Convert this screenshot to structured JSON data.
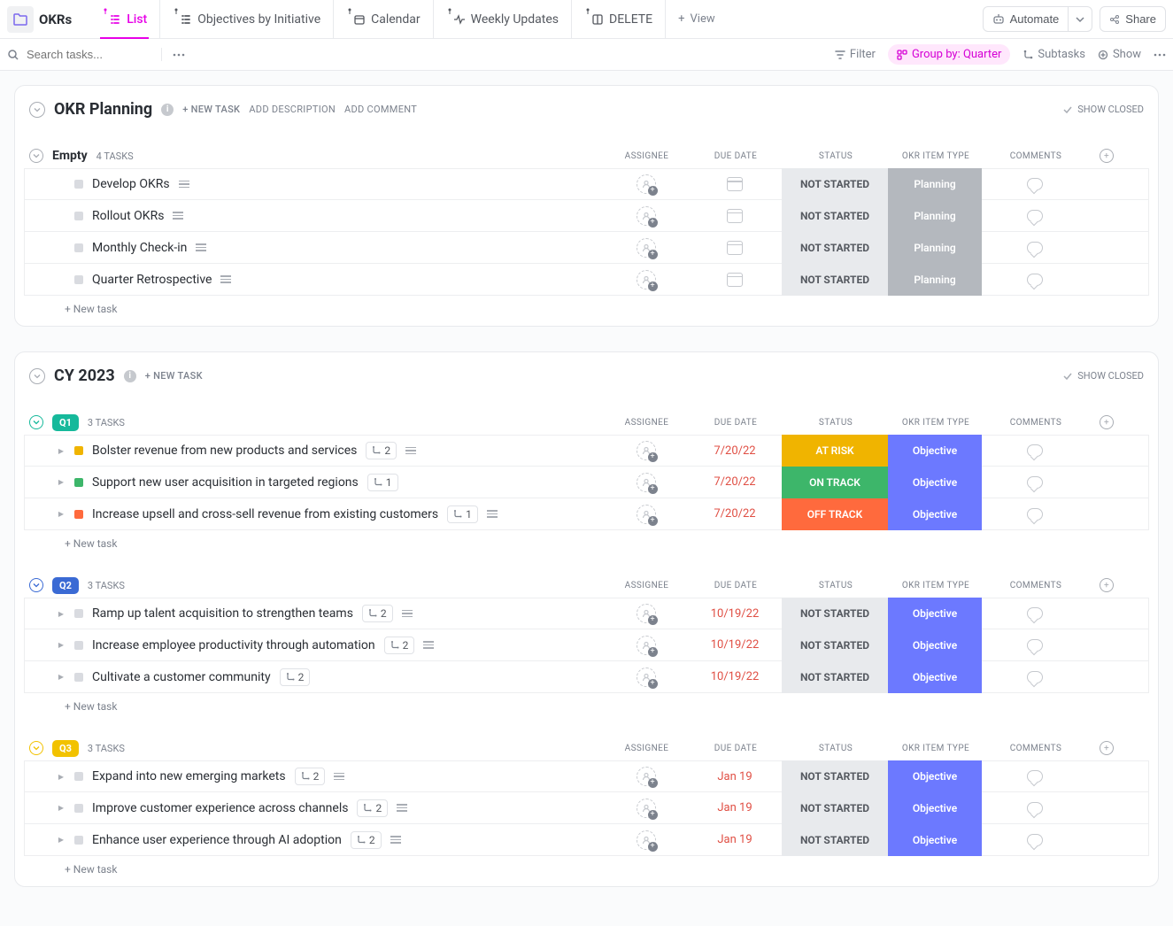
{
  "topbar": {
    "title": "OKRs",
    "views": [
      {
        "label": "List",
        "active": true,
        "icon": "list"
      },
      {
        "label": "Objectives by Initiative",
        "active": false,
        "icon": "list"
      },
      {
        "label": "Calendar",
        "active": false,
        "icon": "calendar"
      },
      {
        "label": "Weekly Updates",
        "active": false,
        "icon": "activity"
      },
      {
        "label": "DELETE",
        "active": false,
        "icon": "board"
      }
    ],
    "add_view": "View",
    "automate": "Automate",
    "share": "Share"
  },
  "filterbar": {
    "search_placeholder": "Search tasks...",
    "filter": "Filter",
    "group_by": "Group by: Quarter",
    "subtasks": "Subtasks",
    "show": "Show"
  },
  "labels": {
    "new_task_caps": "NEW TASK",
    "add_description": "ADD DESCRIPTION",
    "add_comment": "ADD COMMENT",
    "show_closed": "SHOW CLOSED",
    "new_task_row": "New task",
    "columns": {
      "assignee": "ASSIGNEE",
      "due": "DUE DATE",
      "status": "STATUS",
      "type": "OKR ITEM TYPE",
      "comments": "COMMENTS"
    }
  },
  "panels": [
    {
      "title": "OKR Planning",
      "has_info": true,
      "head_actions": [
        "new_task",
        "add_description",
        "add_comment"
      ],
      "groups": [
        {
          "name": "Empty",
          "badge": null,
          "count_text": "4 TASKS",
          "fold_color": "#a9adb4",
          "rows": [
            {
              "title": "Develop OKRs",
              "caret": false,
              "sq": "#d9dbe0",
              "has_desc": true,
              "sub": null,
              "due": null,
              "status": {
                "text": "NOT STARTED",
                "cls": "grey"
              },
              "type": {
                "text": "Planning",
                "cls": "grey"
              }
            },
            {
              "title": "Rollout OKRs",
              "caret": false,
              "sq": "#d9dbe0",
              "has_desc": true,
              "sub": null,
              "due": null,
              "status": {
                "text": "NOT STARTED",
                "cls": "grey"
              },
              "type": {
                "text": "Planning",
                "cls": "grey"
              }
            },
            {
              "title": "Monthly Check-in",
              "caret": false,
              "sq": "#d9dbe0",
              "has_desc": true,
              "sub": null,
              "due": null,
              "status": {
                "text": "NOT STARTED",
                "cls": "grey"
              },
              "type": {
                "text": "Planning",
                "cls": "grey"
              }
            },
            {
              "title": "Quarter Retrospective",
              "caret": false,
              "sq": "#d9dbe0",
              "has_desc": true,
              "sub": null,
              "due": null,
              "status": {
                "text": "NOT STARTED",
                "cls": "grey"
              },
              "type": {
                "text": "Planning",
                "cls": "grey"
              }
            }
          ]
        }
      ]
    },
    {
      "title": "CY 2023",
      "has_info": true,
      "head_actions": [
        "new_task"
      ],
      "groups": [
        {
          "name": "Q1",
          "badge": {
            "text": "Q1",
            "bg": "#16b99b"
          },
          "fold_color": "#16b99b",
          "count_text": "3 TASKS",
          "rows": [
            {
              "title": "Bolster revenue from new products and services",
              "caret": true,
              "sq": "#f0b400",
              "has_desc": true,
              "sub": "2",
              "due": "7/20/22",
              "status": {
                "text": "AT RISK",
                "cls": "atrisk"
              },
              "type": {
                "text": "Objective",
                "cls": "blue"
              }
            },
            {
              "title": "Support new user acquisition in targeted regions",
              "caret": true,
              "sq": "#3db66a",
              "has_desc": false,
              "sub": "1",
              "due": "7/20/22",
              "status": {
                "text": "ON TRACK",
                "cls": "ontrack"
              },
              "type": {
                "text": "Objective",
                "cls": "blue"
              }
            },
            {
              "title": "Increase upsell and cross-sell revenue from existing customers",
              "caret": true,
              "sq": "#ff6a3d",
              "has_desc": true,
              "sub": "1",
              "due": "7/20/22",
              "status": {
                "text": "OFF TRACK",
                "cls": "offtrack"
              },
              "type": {
                "text": "Objective",
                "cls": "blue"
              }
            }
          ]
        },
        {
          "name": "Q2",
          "badge": {
            "text": "Q2",
            "bg": "#3a6ad4"
          },
          "fold_color": "#3a6ad4",
          "count_text": "3 TASKS",
          "rows": [
            {
              "title": "Ramp up talent acquisition to strengthen teams",
              "caret": true,
              "sq": "#d9dbe0",
              "has_desc": true,
              "sub": "2",
              "due": "10/19/22",
              "status": {
                "text": "NOT STARTED",
                "cls": "grey"
              },
              "type": {
                "text": "Objective",
                "cls": "blue"
              }
            },
            {
              "title": "Increase employee productivity through automation",
              "caret": true,
              "sq": "#d9dbe0",
              "has_desc": true,
              "sub": "2",
              "due": "10/19/22",
              "status": {
                "text": "NOT STARTED",
                "cls": "grey"
              },
              "type": {
                "text": "Objective",
                "cls": "blue"
              }
            },
            {
              "title": "Cultivate a customer community",
              "caret": true,
              "sq": "#d9dbe0",
              "has_desc": false,
              "sub": "2",
              "due": "10/19/22",
              "status": {
                "text": "NOT STARTED",
                "cls": "grey"
              },
              "type": {
                "text": "Objective",
                "cls": "blue"
              }
            }
          ]
        },
        {
          "name": "Q3",
          "badge": {
            "text": "Q3",
            "bg": "#f2c200"
          },
          "fold_color": "#f2c200",
          "count_text": "3 TASKS",
          "rows": [
            {
              "title": "Expand into new emerging markets",
              "caret": true,
              "sq": "#d9dbe0",
              "has_desc": true,
              "sub": "2",
              "due": "Jan 19",
              "status": {
                "text": "NOT STARTED",
                "cls": "grey"
              },
              "type": {
                "text": "Objective",
                "cls": "blue"
              }
            },
            {
              "title": "Improve customer experience across channels",
              "caret": true,
              "sq": "#d9dbe0",
              "has_desc": true,
              "sub": "2",
              "due": "Jan 19",
              "status": {
                "text": "NOT STARTED",
                "cls": "grey"
              },
              "type": {
                "text": "Objective",
                "cls": "blue"
              }
            },
            {
              "title": "Enhance user experience through AI adoption",
              "caret": true,
              "sq": "#d9dbe0",
              "has_desc": true,
              "sub": "2",
              "due": "Jan 19",
              "status": {
                "text": "NOT STARTED",
                "cls": "grey"
              },
              "type": {
                "text": "Objective",
                "cls": "blue"
              }
            }
          ]
        }
      ]
    }
  ]
}
